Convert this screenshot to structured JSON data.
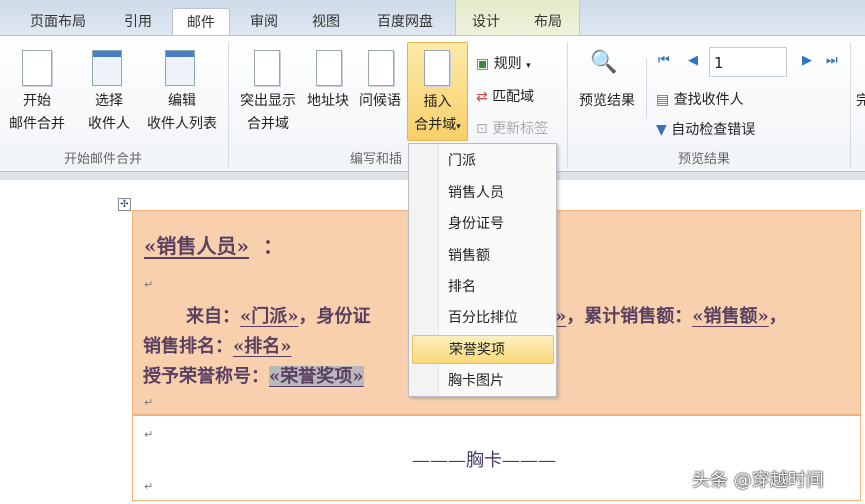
{
  "tabs": [
    "页面布局",
    "引用",
    "邮件",
    "审阅",
    "视图",
    "百度网盘",
    "设计",
    "布局"
  ],
  "active_tab": "邮件",
  "ribbon": {
    "start_group": {
      "label": "开始邮件合并",
      "buttons": [
        {
          "l1": "开始",
          "l2": "邮件合并"
        },
        {
          "l1": "选择",
          "l2": "收件人"
        },
        {
          "l1": "编辑",
          "l2": "收件人列表"
        }
      ]
    },
    "write_group": {
      "label": "编写和插",
      "buttons": [
        {
          "l1": "突出显示",
          "l2": "合并域"
        },
        {
          "l1": "地址块"
        },
        {
          "l1": "问候语"
        },
        {
          "l1": "插入",
          "l2": "合并域"
        }
      ],
      "small": [
        "规则",
        "匹配域",
        "更新标签"
      ]
    },
    "preview_group": {
      "label": "预览结果",
      "preview_button": "预览结果",
      "record": "1",
      "small": [
        "查找收件人",
        "自动检查错误"
      ]
    },
    "cut_text": "完"
  },
  "menu": {
    "items": [
      "门派",
      "销售人员",
      "身份证号",
      "销售额",
      "排名",
      "百分比排位",
      "荣誉奖项",
      "胸卡图片"
    ],
    "highlighted": "荣誉奖项"
  },
  "doc": {
    "field_salesperson": "«销售人员»",
    "colon": "：",
    "from_label": "来自：",
    "field_sect": "«门派»",
    "id_part": "，身份证",
    "field_end": "»",
    "total_label": "，累计销售额：",
    "field_sales": "«销售额»",
    "comma": "，",
    "rank_label": "销售排名：",
    "field_rank": "«排名»",
    "honor_label": "授予荣誉称号：",
    "field_honor": "«荣誉奖项»",
    "badge": "———胸卡———"
  },
  "watermark": "头条 @穿越时间"
}
